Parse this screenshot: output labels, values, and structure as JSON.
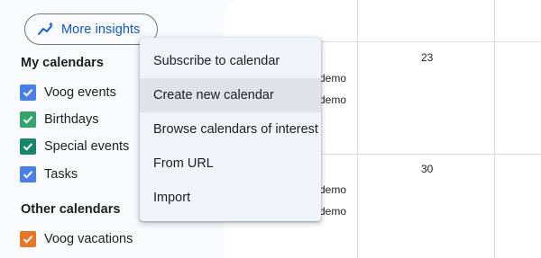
{
  "sidebar": {
    "insights_button": {
      "label": "More insights",
      "icon": "insights-icon"
    },
    "my_calendars": {
      "title": "My calendars",
      "items": [
        {
          "label": "Voog events",
          "color": "#4a7fe6",
          "checked": true
        },
        {
          "label": "Birthdays",
          "color": "#34a46a",
          "checked": true
        },
        {
          "label": "Special events",
          "color": "#188768",
          "checked": true
        },
        {
          "label": "Tasks",
          "color": "#4a7fe6",
          "checked": true
        }
      ]
    },
    "other_calendars": {
      "title": "Other calendars",
      "items": [
        {
          "label": "Voog vacations",
          "color": "#e57727",
          "checked": true
        }
      ]
    }
  },
  "calendar": {
    "days": [
      {
        "number": "23",
        "events": [
          "demo",
          "demo"
        ]
      },
      {
        "number": "30",
        "events": [
          "demo",
          "demo"
        ]
      }
    ]
  },
  "menu": {
    "items": [
      {
        "label": "Subscribe to calendar",
        "highlighted": false
      },
      {
        "label": "Create new calendar",
        "highlighted": true
      },
      {
        "label": "Browse calendars of interest",
        "highlighted": false
      },
      {
        "label": "From URL",
        "highlighted": false
      },
      {
        "label": "Import",
        "highlighted": false
      }
    ]
  }
}
